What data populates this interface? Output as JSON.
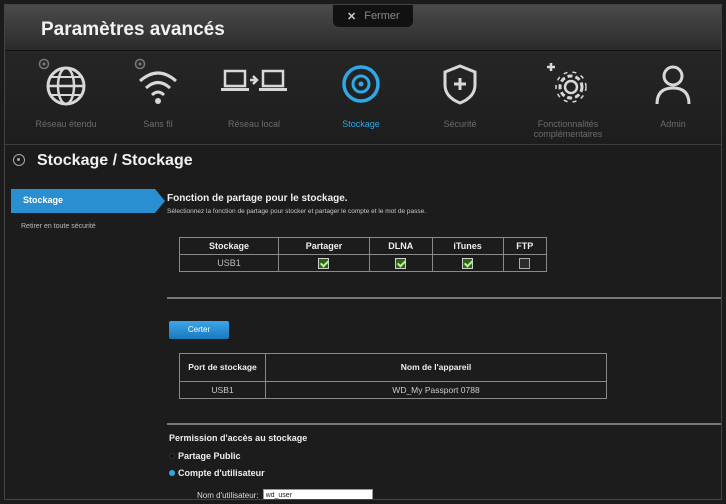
{
  "window": {
    "title": "Paramètres avancés",
    "close_label": "Fermer"
  },
  "nav": [
    {
      "label": "Réseau étendu",
      "icon": "globe-icon"
    },
    {
      "label": "Sans fil",
      "icon": "wifi-icon"
    },
    {
      "label": "Réseau local",
      "icon": "lan-icon"
    },
    {
      "label": "Stockage",
      "icon": "storage-icon",
      "active": true
    },
    {
      "label": "Sécurité",
      "icon": "shield-icon"
    },
    {
      "label": "Fonctionnalités complémentaires",
      "icon": "gear-icon"
    },
    {
      "label": "Admin",
      "icon": "user-icon"
    }
  ],
  "section": {
    "title": "Stockage / Stockage"
  },
  "sidebar": {
    "items": [
      {
        "label": "Stockage",
        "active": true
      },
      {
        "label": "Retirer en toute sécurité"
      }
    ]
  },
  "sharing": {
    "heading": "Fonction de partage pour le stockage.",
    "description": "Sélectionnez la fonction de partage pour stocker et partager le compte et le mot de passe.",
    "headers": [
      "Stockage",
      "Partager",
      "DLNA",
      "iTunes",
      "FTP"
    ],
    "rows": [
      {
        "storage": "USB1",
        "partager": true,
        "dlna": true,
        "itunes": true,
        "ftp": false
      }
    ]
  },
  "refresh_button": "Certer",
  "ports": {
    "headers": [
      "Port de stockage",
      "Nom de l'appareil"
    ],
    "rows": [
      {
        "port": "USB1",
        "name": "WD_My Passport 0788"
      }
    ]
  },
  "permission": {
    "title": "Permission d'accès au stockage",
    "option_public": "Partage Public",
    "option_user": "Compte d'utilisateur",
    "selected": "user",
    "username_label": "Nom d'utilisateur:",
    "username_value": "wd_user"
  },
  "colors": {
    "accent": "#2a8fd0",
    "active_nav": "#2ea8e6",
    "background": "#1c1c1c"
  }
}
